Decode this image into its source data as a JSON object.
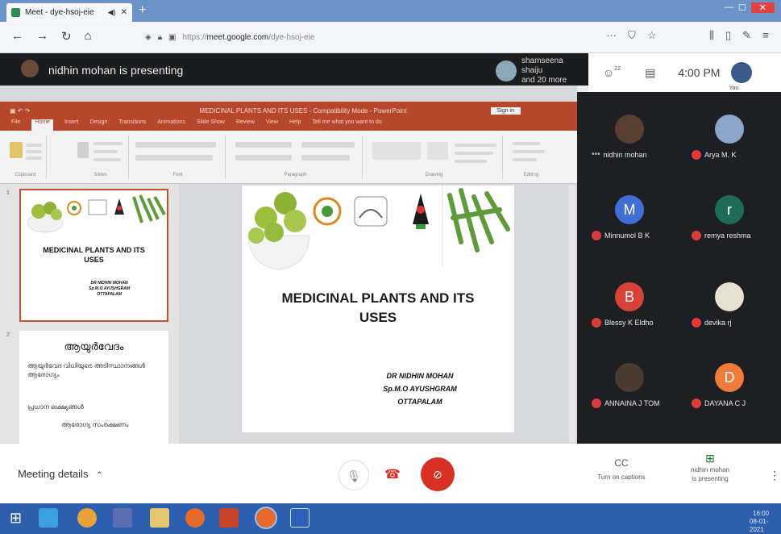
{
  "browser": {
    "tab_title": "Meet - dye-hsoj-eie",
    "tab_sound": "◀)",
    "tab_close": "✕",
    "new_tab": "+",
    "url_prefix": "https://",
    "url_domain": "meet.google.com",
    "url_path": "/dye-hsoj-eie",
    "more": "···"
  },
  "meet": {
    "presenter_banner": "nidhin mohan is presenting",
    "others_name": "shamseena shaiju",
    "others_more": "and 20 more",
    "people_count": "22",
    "time": "4:00 PM",
    "you_label": "You"
  },
  "ppt": {
    "window_title": "MEDICINAL PLANTS AND ITS USES - Compatibility Mode - PowerPoint",
    "sign_in": "Sign in",
    "tabs": [
      "File",
      "Home",
      "Insert",
      "Design",
      "Transitions",
      "Animations",
      "Slide Show",
      "Review",
      "View",
      "Help",
      "Tell me what you want to do"
    ],
    "group_labels": [
      "Clipboard",
      "Slides",
      "Font",
      "Paragraph",
      "Drawing",
      "Editing"
    ],
    "thumb_numbers": [
      "1",
      "2"
    ],
    "slide1": {
      "title_line1": "MEDICINAL PLANTS AND ITS",
      "title_line2": "USES",
      "author_line1": "DR NIDHIN MOHAN",
      "author_line2": "Sp.M.O AYUSHGRAM",
      "author_line3": "OTTAPALAM"
    },
    "slide2": {
      "heading": "ആയുർവേദം",
      "bullet1": "ആയുർവേദ വിധിയുടെ അടിസ്ഥാനങ്ങൾ ആരോഗ്യം",
      "bullet2": "പ്രധാന ലക്ഷ്യങ്ങൾ",
      "bullet3": "ആരോഗ്യ സംരക്ഷണം"
    }
  },
  "participants": [
    {
      "name": "nidhin mohan",
      "initial": "",
      "color": "#5a4032",
      "muted": false
    },
    {
      "name": "Arya M. K",
      "initial": "",
      "color": "#8aa6c9",
      "muted": true
    },
    {
      "name": "Minnumol B K",
      "initial": "M",
      "color": "#3f6fd6",
      "muted": true
    },
    {
      "name": "remya reshma",
      "initial": "r",
      "color": "#1f6b5a",
      "muted": true
    },
    {
      "name": "Blessy K Eldho",
      "initial": "B",
      "color": "#d8423b",
      "muted": true
    },
    {
      "name": "devika rj",
      "initial": "",
      "color": "#e8e1d2",
      "muted": true
    },
    {
      "name": "ANNAINA J TOM",
      "initial": "",
      "color": "#4a3a30",
      "muted": true
    },
    {
      "name": "DAYANA C J",
      "initial": "D",
      "color": "#f07a3a",
      "muted": true
    }
  ],
  "bottom": {
    "meeting_details": "Meeting details",
    "captions": "Turn on captions",
    "captions_icon": "CC",
    "presenting_line1": "nidhin mohan",
    "presenting_line2": "is presenting"
  },
  "taskbar": {
    "time": "16:00",
    "date": "08-01-2021"
  }
}
